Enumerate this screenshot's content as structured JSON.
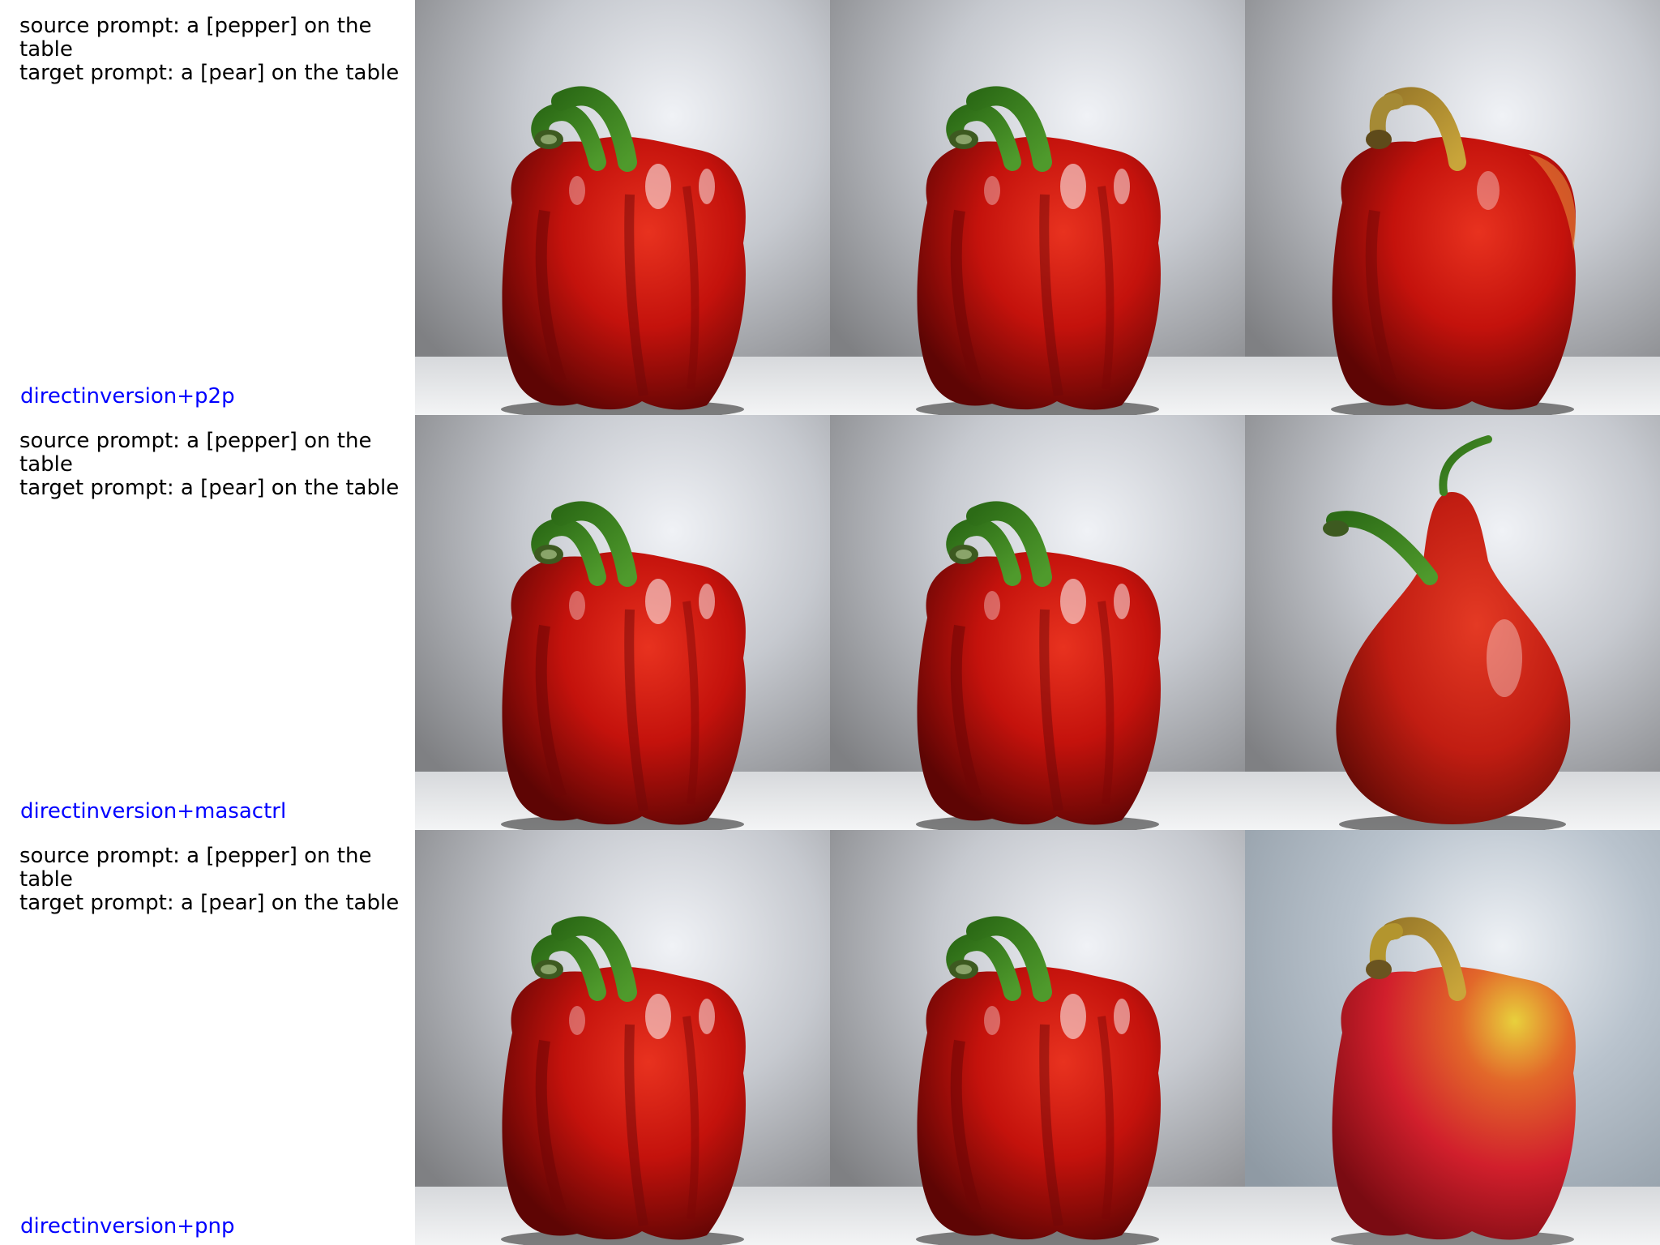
{
  "rows": [
    {
      "source_prompt": "source prompt: a [pepper] on the table",
      "target_prompt": "target prompt: a [pear] on the table",
      "method": "directinversion+p2p",
      "images": [
        "red-bell-pepper-source",
        "red-bell-pepper-reconstruction",
        "red-pear-pepper-edit"
      ]
    },
    {
      "source_prompt": "source prompt: a [pepper] on the table",
      "target_prompt": "target prompt: a [pear] on the table",
      "method": "directinversion+masactrl",
      "images": [
        "red-bell-pepper-source",
        "red-bell-pepper-reconstruction",
        "red-pear-edit"
      ]
    },
    {
      "source_prompt": "source prompt: a [pepper] on the table",
      "target_prompt": "target prompt: a [pear] on the table",
      "method": "directinversion+pnp",
      "images": [
        "red-bell-pepper-source",
        "red-bell-pepper-reconstruction",
        "red-yellow-pear-pepper-edit"
      ]
    }
  ],
  "colors": {
    "method_label": "#0000ff",
    "prompt_text": "#000000",
    "pepper_red": "#c4120c",
    "stem_green": "#3f8a22",
    "pear_yellow": "#d9b43a"
  }
}
